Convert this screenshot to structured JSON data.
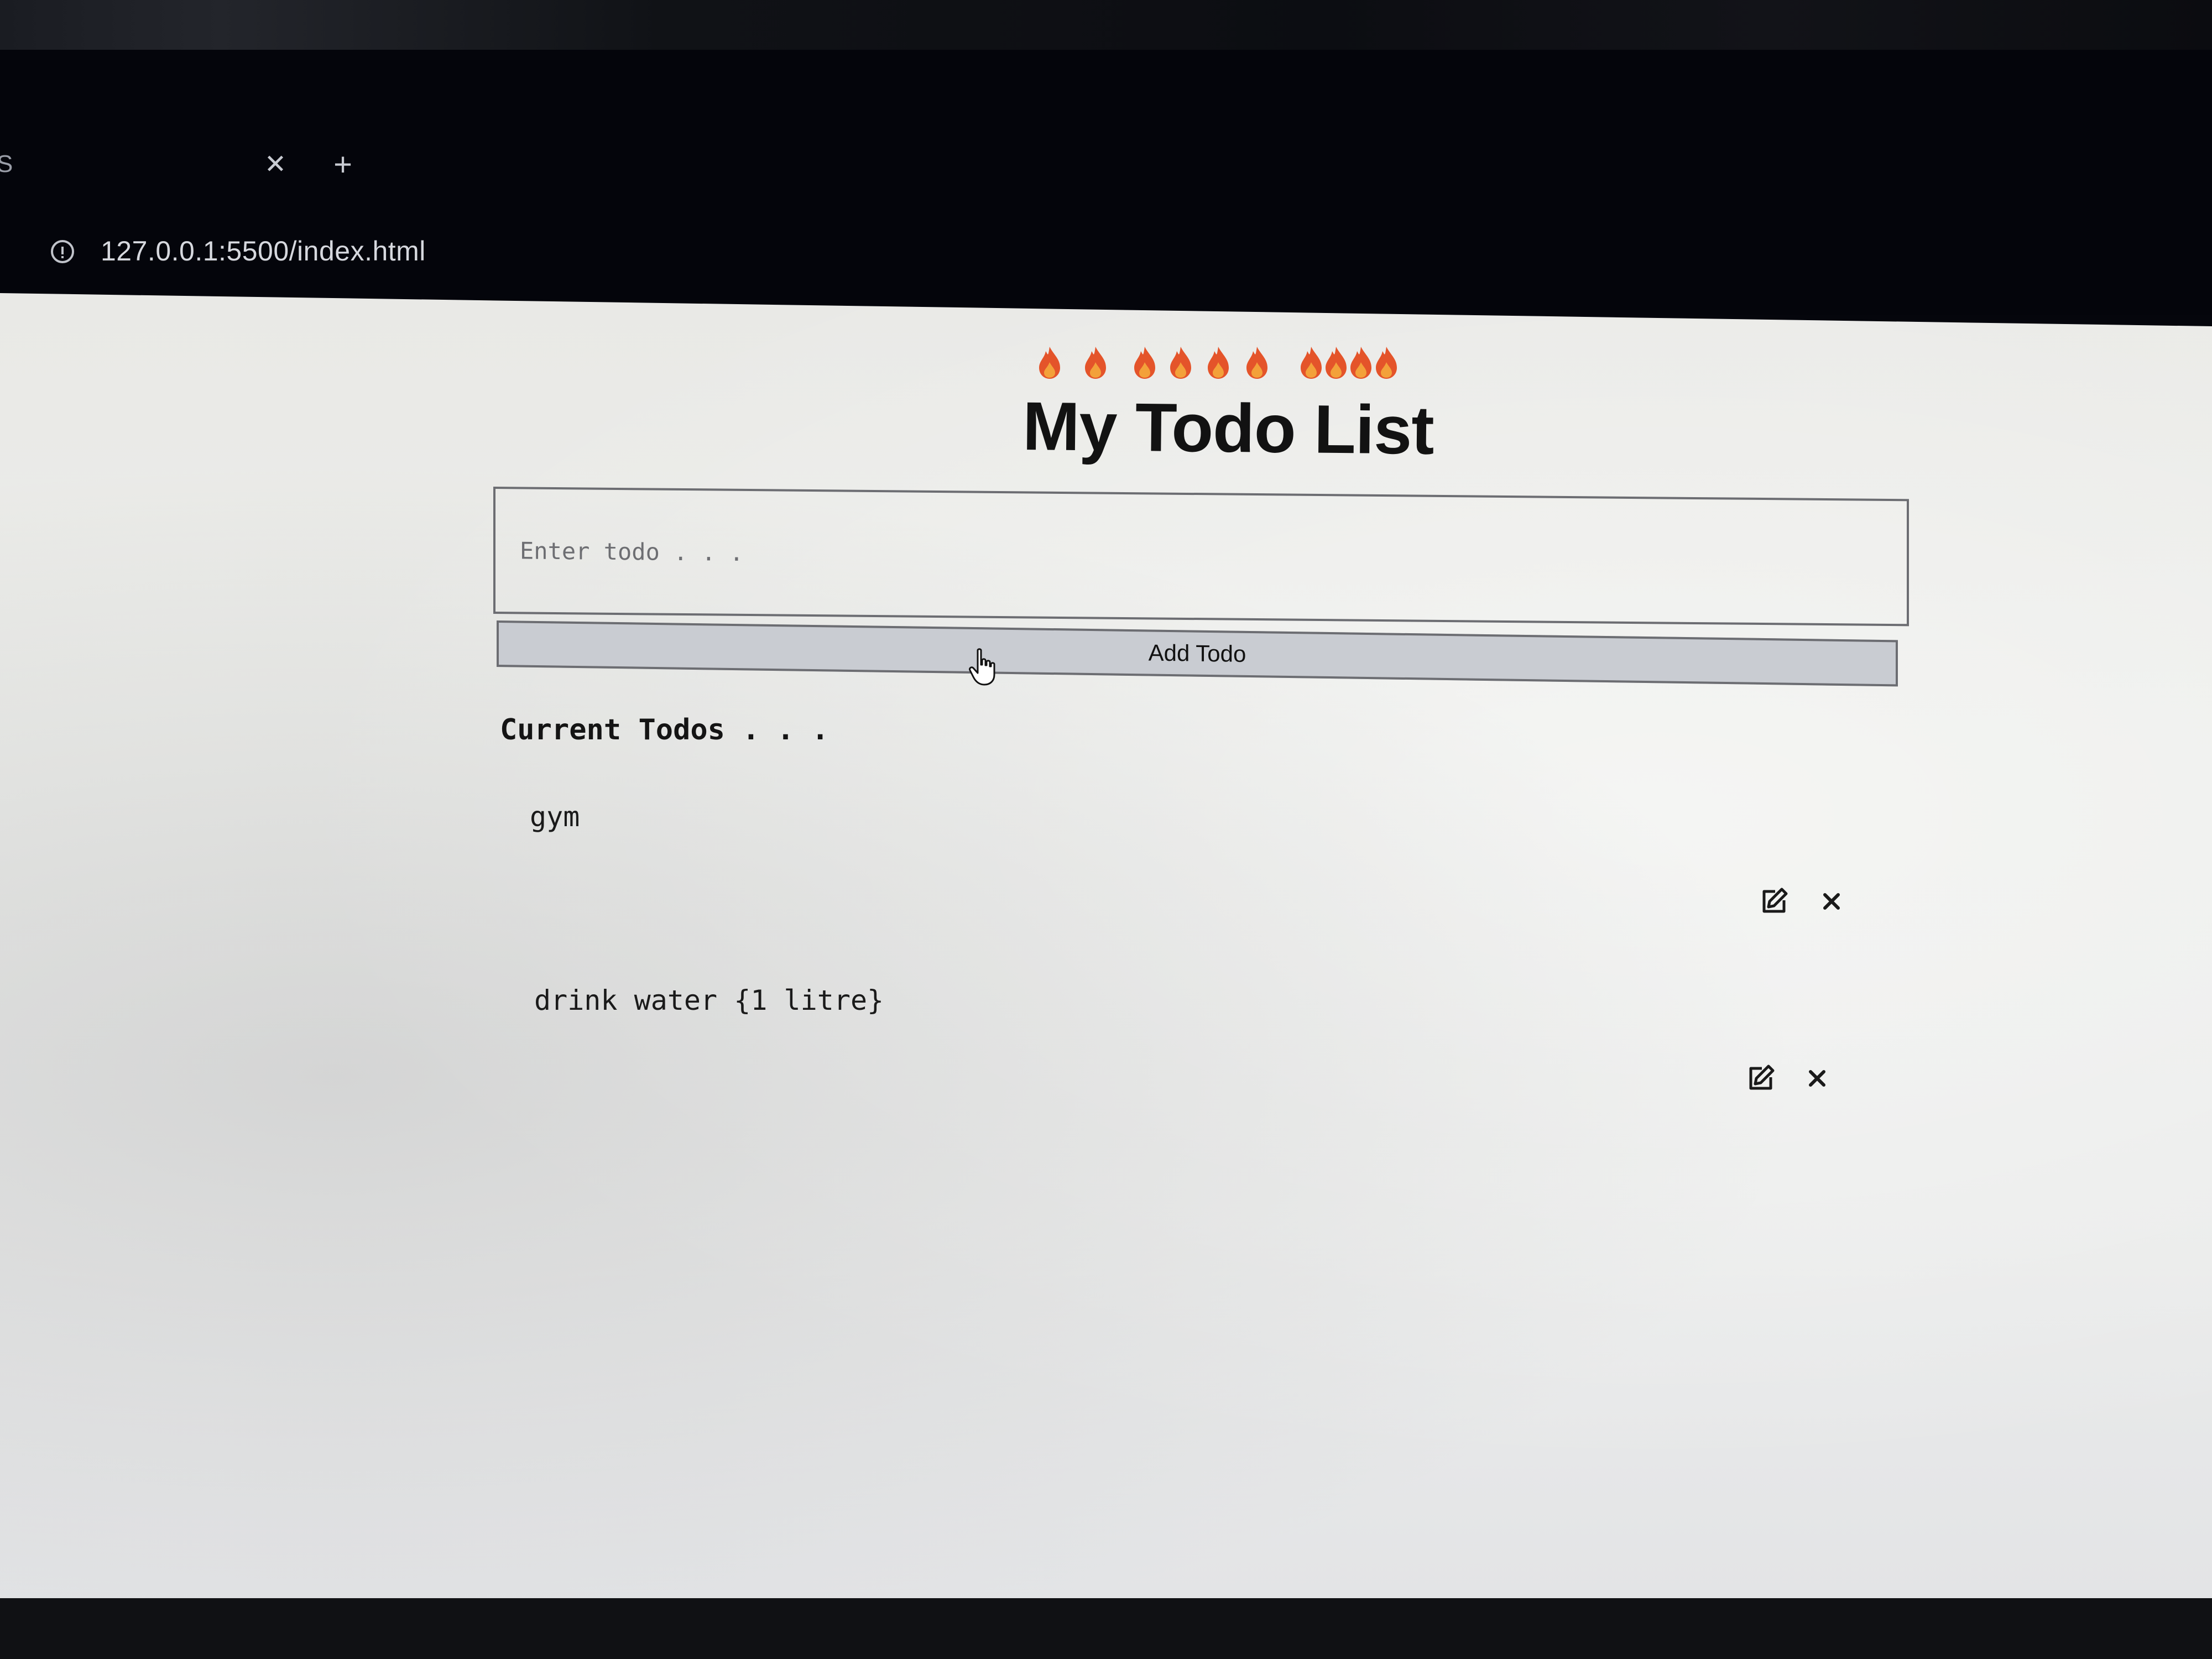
{
  "browser": {
    "tab_title": "S",
    "tab_close_icon": "close-icon",
    "new_tab_icon": "plus-icon",
    "url": "127.0.0.1:5500/index.html"
  },
  "header": {
    "emoji_row": "🔥🔥🔥🔥🔥🔥🔥🔥🔥🔥",
    "title": "My Todo List"
  },
  "form": {
    "input_value": "",
    "input_placeholder": "Enter todo . . .",
    "add_button_label": "Add Todo"
  },
  "todos_section": {
    "title": "Current Todos . . .",
    "items": [
      {
        "text": "gym",
        "edit_icon": "edit-icon",
        "delete_icon": "close-icon"
      },
      {
        "text": "drink water {1 litre}",
        "edit_icon": "edit-icon",
        "delete_icon": "close-icon"
      }
    ]
  },
  "colors": {
    "flame_outer": "#e4542a",
    "flame_inner": "#f3a13a",
    "button_bg": "#c9ccd2",
    "page_bg": "#ebebe8",
    "chrome_bg": "#04050b"
  }
}
